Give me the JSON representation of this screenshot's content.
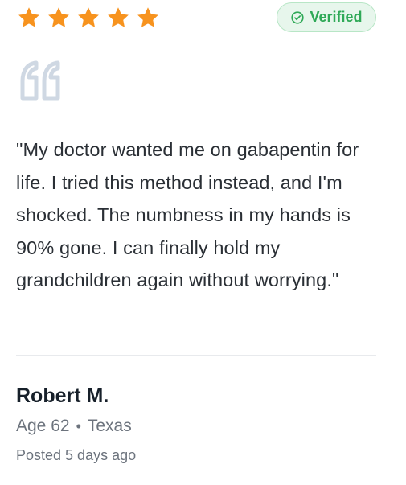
{
  "rating": {
    "stars": 5,
    "max": 5,
    "color": "#f7931e"
  },
  "badge": {
    "label": "Verified",
    "icon": "check-circle-icon",
    "color": "#2fa957"
  },
  "quote_icon": "quote-icon",
  "testimonial": {
    "text": "\"My doctor wanted me on gabapentin for life. I tried this method instead, and I'm shocked. The numbness in my hands is 90% gone. I can finally hold my grandchildren again without worrying.\""
  },
  "author": {
    "name": "Robert M.",
    "age": "Age 62",
    "separator": "•",
    "location": "Texas",
    "posted": "Posted 5 days ago"
  }
}
